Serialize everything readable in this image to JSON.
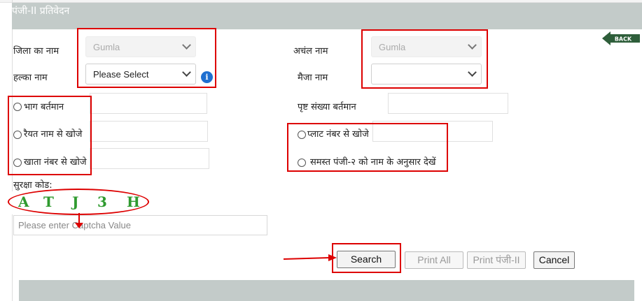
{
  "header": {
    "title": "पंजी-II प्रतिवेदन"
  },
  "back": {
    "label": "BACK"
  },
  "form": {
    "district": {
      "label": "जिला का नाम",
      "value": "Gumla"
    },
    "circle": {
      "label": "अचंल नाम",
      "value": "Gumla"
    },
    "halka": {
      "label": "हल्का नाम",
      "value": "Please Select"
    },
    "mauza": {
      "label": "मैजा नाम",
      "value": ""
    },
    "bhag": {
      "label": "भाग बर्तमान"
    },
    "page_no": {
      "label": "पृष्ट संख्या बर्तमान"
    },
    "raiyat": {
      "label": "रैयत नाम से खोजे"
    },
    "plot": {
      "label": "प्लाट नंबर से खोजे"
    },
    "khata": {
      "label": "खाता नंबर से खोजे"
    },
    "all_panji": {
      "label": "समस्त पंजी-२ को नाम के अनुसार देखें"
    },
    "captcha": {
      "label": "सुरक्षा कोड:",
      "chars": [
        "A",
        "T",
        "J",
        "3",
        "H"
      ],
      "placeholder": "Please enter Captcha Value"
    }
  },
  "buttons": {
    "search": "Search",
    "print_all": "Print All",
    "print_panji": "Print पंजी-II",
    "cancel": "Cancel"
  },
  "colors": {
    "header_bg": "#c3cbc9",
    "annotation_red": "#dd0000",
    "captcha_green": "#2f9a2f",
    "info_blue": "#1f6fd0"
  }
}
